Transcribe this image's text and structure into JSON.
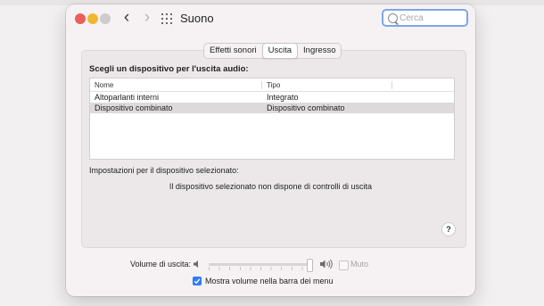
{
  "window": {
    "title": "Suono",
    "nav": {
      "back_icon": "chevron-left-icon",
      "forward_icon": "chevron-right-icon",
      "grid_icon": "grid-icon"
    }
  },
  "search": {
    "placeholder": "Cerca",
    "value": ""
  },
  "tabs": [
    {
      "label": "Effetti sonori",
      "active": false
    },
    {
      "label": "Uscita",
      "active": true
    },
    {
      "label": "Ingresso",
      "active": false
    }
  ],
  "output": {
    "choose_label": "Scegli un dispositivo per l'uscita audio:",
    "table": {
      "headers": [
        "Nome",
        "Tipo"
      ],
      "rows": [
        {
          "name": "Altoparlanti interni",
          "type": "Integrato",
          "selected": false
        },
        {
          "name": "Dispositivo combinato",
          "type": "Dispositivo combinato",
          "selected": true
        }
      ]
    },
    "settings_label": "Impostazioni per il dispositivo selezionato:",
    "no_controls_message": "Il dispositivo selezionato non dispone di controlli di uscita",
    "help_label": "?"
  },
  "volume": {
    "label": "Volume di uscita:",
    "level": 1.0,
    "mute_label": "Muto",
    "mute_checked": false,
    "mute_enabled": false
  },
  "menu_bar": {
    "label": "Mostra volume nella barra dei menu",
    "checked": true
  },
  "colors": {
    "accent": "#2f7cf6",
    "close": "#ec5f58",
    "minimize": "#f2b72f",
    "search_focus": "#7ba7e6"
  }
}
